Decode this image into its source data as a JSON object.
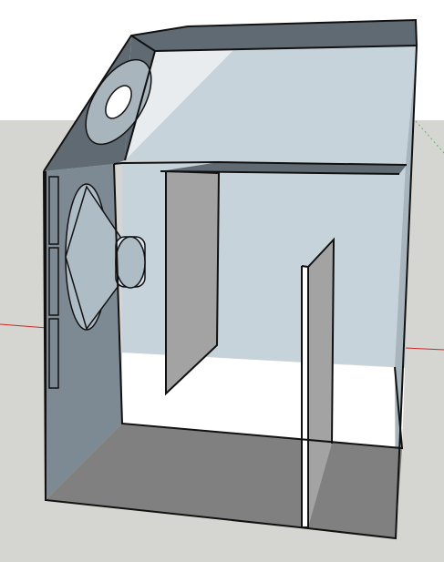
{
  "scene": {
    "colors": {
      "sky": "#ffffff",
      "ground": "#d5d5d1",
      "outline": "#111111",
      "red_axis": "#cc2a2a",
      "green_axis": "#5fb56a",
      "panel_light": "#c6d3db",
      "panel_mid": "#a9b5bc",
      "panel_dark": "#7d8a93",
      "panel_darker": "#5f6a72",
      "floor": "#808080",
      "baffle": "#a3a3a3",
      "speaker_light": "#dbe7ef",
      "speaker_mid": "#aebcc5",
      "speaker_dark": "#7f8d96"
    },
    "icons": {
      "speaker_driver": "speaker-icon",
      "port_tube": "port-icon",
      "axis": "axis-line-icon"
    }
  }
}
